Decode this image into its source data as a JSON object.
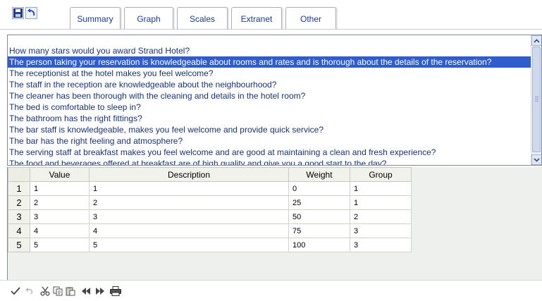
{
  "toolbar": {
    "save_icon": "floppy-disk-icon",
    "undo_icon": "undo-arrow-icon"
  },
  "tabs": [
    {
      "label": "Summary"
    },
    {
      "label": "Graph"
    },
    {
      "label": "Scales"
    },
    {
      "label": "Extranet"
    },
    {
      "label": "Other"
    }
  ],
  "questions": {
    "selected_index": 1,
    "items": [
      "How many stars would you award Strand Hotel?",
      "The person taking your reservation is knowledgeable about rooms and rates and is thorough about the details of the reservation?",
      "The receptionist at the hotel makes you feel welcome?",
      "The staff in the reception are knowledgeable about the neighbourhood?",
      "The cleaner has been thorough with the cleaning and details in the hotel room?",
      "The bed is comfortable to sleep in?",
      "The bathroom has the right fittings?",
      "The bar staff is knowledgeable, makes you feel welcome and provide quick service?",
      "The bar has the right feeling and atmosphere?",
      "The serving staff at breakfast makes you feel welcome and are good at maintaining a clean and fresh experience?",
      "The food and beverages offered at breakfast are of high quality and give you a good start to the day?"
    ]
  },
  "grid": {
    "columns": [
      "Value",
      "Description",
      "Weight",
      "Group"
    ],
    "rows": [
      {
        "num": "1",
        "value": "1",
        "description": "1",
        "weight": "0",
        "group": "1"
      },
      {
        "num": "2",
        "value": "2",
        "description": "2",
        "weight": "25",
        "group": "1"
      },
      {
        "num": "3",
        "value": "3",
        "description": "3",
        "weight": "50",
        "group": "2"
      },
      {
        "num": "4",
        "value": "4",
        "description": "4",
        "weight": "75",
        "group": "3"
      },
      {
        "num": "5",
        "value": "5",
        "description": "5",
        "weight": "100",
        "group": "3"
      }
    ]
  },
  "bottom_toolbar": {
    "icons": [
      "checkmark-icon",
      "undo-icon",
      "cut-icon",
      "copy-icon",
      "paste-icon",
      "rewind-icon",
      "fast-forward-icon",
      "print-icon"
    ]
  },
  "colors": {
    "selection": "#2f5dd0",
    "item_text": "#18337a",
    "tab_text": "#1a3aa6"
  }
}
